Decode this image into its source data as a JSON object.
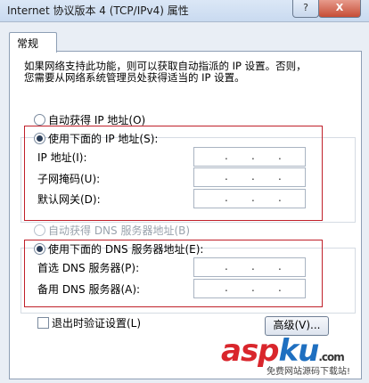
{
  "window": {
    "title": "Internet 协议版本 4 (TCP/IPv4) 属性",
    "help_label": "?",
    "close_label": "X"
  },
  "tabs": [
    {
      "label": "常规"
    }
  ],
  "intro": {
    "line1": "如果网络支持此功能，则可以获取自动指派的 IP 设置。否则，",
    "line2": "您需要从网络系统管理员处获得适当的 IP 设置。"
  },
  "ip": {
    "auto_label": "自动获得 IP 地址(O)",
    "manual_label": "使用下面的 IP 地址(S):",
    "address_label": "IP 地址(I):",
    "subnet_label": "子网掩码(U):",
    "gateway_label": "默认网关(D):"
  },
  "dns": {
    "auto_label": "自动获得 DNS 服务器地址(B)",
    "manual_label": "使用下面的 DNS 服务器地址(E):",
    "preferred_label": "首选 DNS 服务器(P):",
    "alternate_label": "备用 DNS 服务器(A):"
  },
  "validate_label": "退出时验证设置(L)",
  "advanced_label": "高级(V)...",
  "watermark": {
    "text_a": "asp",
    "text_b": "ku",
    "suffix": ".com",
    "sub": "免费网站源码下载站!"
  },
  "colors": {
    "highlight_box": "#c0202a",
    "panel_border": "#8e9fb5"
  }
}
